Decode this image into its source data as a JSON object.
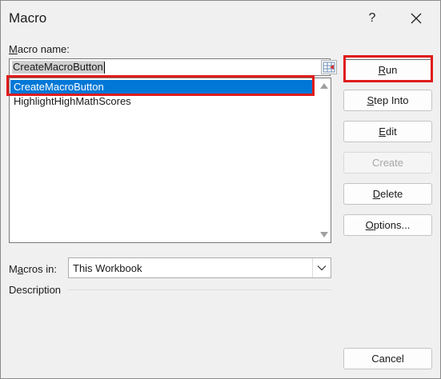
{
  "dialog": {
    "title": "Macro",
    "help_label": "?"
  },
  "macro_name": {
    "label_hotkey": "M",
    "label_rest": "acro name:",
    "value": "CreateMacroButton"
  },
  "macros": [
    {
      "name": "CreateMacroButton",
      "selected": true
    },
    {
      "name": "HighlightHighMathScores",
      "selected": false
    }
  ],
  "macros_in": {
    "label_pre": "M",
    "label_hotkey": "a",
    "label_rest": "cros in:",
    "value": "This Workbook"
  },
  "description": {
    "label": "Description"
  },
  "buttons": {
    "run": {
      "hotkey": "R",
      "rest": "un"
    },
    "step_into": {
      "hotkey": "S",
      "rest": "tep Into"
    },
    "edit": {
      "hotkey": "E",
      "rest": "dit"
    },
    "create": {
      "label": "Create"
    },
    "delete": {
      "hotkey": "D",
      "rest": "elete"
    },
    "options": {
      "hotkey": "O",
      "rest": "ptions..."
    },
    "cancel": {
      "label": "Cancel"
    }
  },
  "colors": {
    "selection": "#0078d7",
    "highlight": "#e01b1b"
  }
}
